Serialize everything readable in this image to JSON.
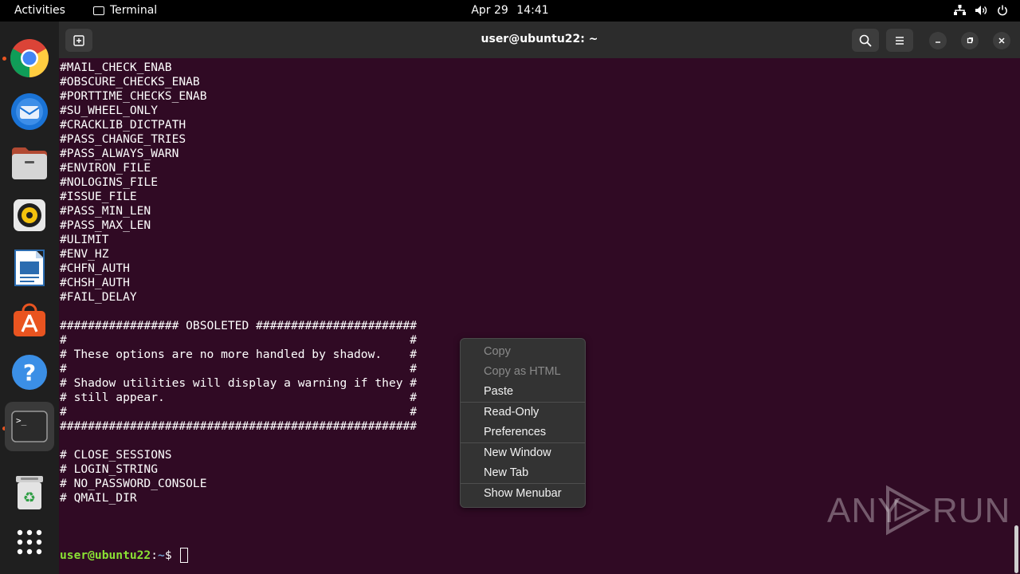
{
  "topbar": {
    "activities": "Activities",
    "app_name": "Terminal",
    "date": "Apr 29",
    "time": "14:41"
  },
  "dock": {
    "items": [
      {
        "name": "chrome",
        "running": true
      },
      {
        "name": "thunderbird",
        "running": false
      },
      {
        "name": "files",
        "running": false
      },
      {
        "name": "rhythmbox",
        "running": false
      },
      {
        "name": "libreoffice-writer",
        "running": false
      },
      {
        "name": "ubuntu-software",
        "running": false
      },
      {
        "name": "help",
        "running": false
      },
      {
        "name": "terminal",
        "running": true
      },
      {
        "name": "trash",
        "running": false
      },
      {
        "name": "show-apps",
        "running": false
      }
    ]
  },
  "window": {
    "title": "user@ubuntu22: ~"
  },
  "terminal": {
    "lines": [
      "#MAIL_CHECK_ENAB",
      "#OBSCURE_CHECKS_ENAB",
      "#PORTTIME_CHECKS_ENAB",
      "#SU_WHEEL_ONLY",
      "#CRACKLIB_DICTPATH",
      "#PASS_CHANGE_TRIES",
      "#PASS_ALWAYS_WARN",
      "#ENVIRON_FILE",
      "#NOLOGINS_FILE",
      "#ISSUE_FILE",
      "#PASS_MIN_LEN",
      "#PASS_MAX_LEN",
      "#ULIMIT",
      "#ENV_HZ",
      "#CHFN_AUTH",
      "#CHSH_AUTH",
      "#FAIL_DELAY",
      "",
      "################# OBSOLETED #######################",
      "#                                                 #",
      "# These options are no more handled by shadow.    #",
      "#                                                 #",
      "# Shadow utilities will display a warning if they #",
      "# still appear.                                   #",
      "#                                                 #",
      "###################################################",
      "",
      "# CLOSE_SESSIONS",
      "# LOGIN_STRING",
      "# NO_PASSWORD_CONSOLE",
      "# QMAIL_DIR"
    ],
    "prompt_user": "user@ubuntu22",
    "prompt_sep": ":",
    "prompt_path": "~",
    "prompt_symbol": "$ "
  },
  "context_menu": {
    "groups": [
      [
        {
          "label": "Copy",
          "enabled": false
        },
        {
          "label": "Copy as HTML",
          "enabled": false
        },
        {
          "label": "Paste",
          "enabled": true
        }
      ],
      [
        {
          "label": "Read-Only",
          "enabled": true
        },
        {
          "label": "Preferences",
          "enabled": true
        }
      ],
      [
        {
          "label": "New Window",
          "enabled": true
        },
        {
          "label": "New Tab",
          "enabled": true
        }
      ],
      [
        {
          "label": "Show Menubar",
          "enabled": true
        }
      ]
    ]
  },
  "watermark": {
    "left": "ANY",
    "right": "RUN"
  },
  "colors": {
    "terminal_bg": "#300a24",
    "prompt_user": "#8ae234",
    "prompt_path": "#729fcf",
    "accent": "#e95420"
  }
}
